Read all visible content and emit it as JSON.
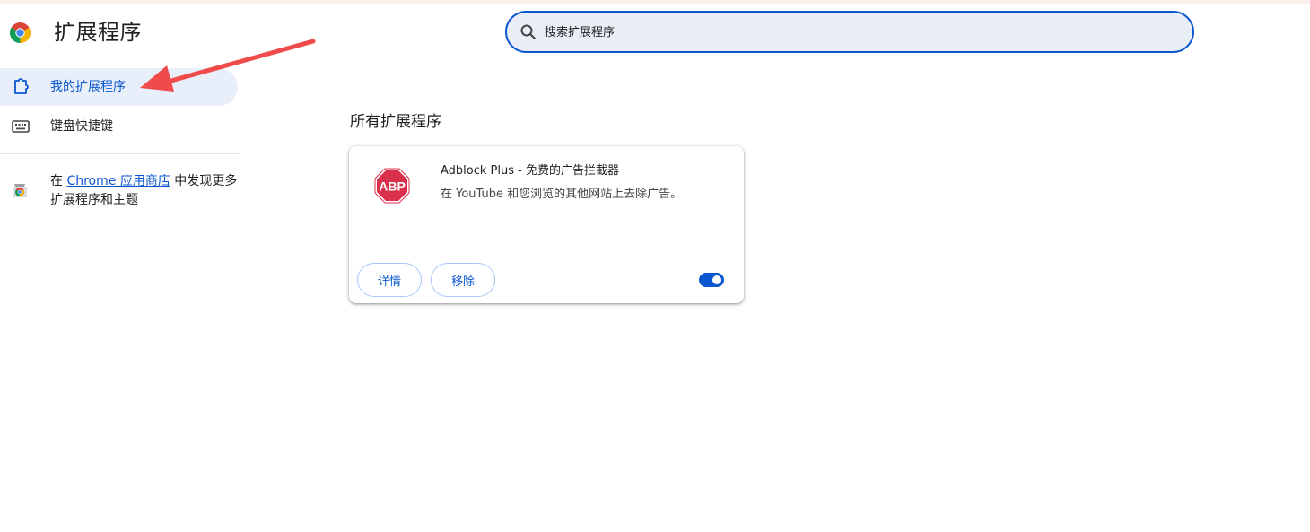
{
  "app": {
    "title": "扩展程序"
  },
  "search": {
    "placeholder": "搜索扩展程序",
    "value": ""
  },
  "sidebar": {
    "items": [
      {
        "label": "我的扩展程序",
        "icon": "puzzle-icon",
        "active": true
      },
      {
        "label": "键盘快捷键",
        "icon": "keyboard-icon",
        "active": false
      }
    ],
    "store_promo": {
      "prefix": "在 ",
      "link_text": "Chrome 应用商店",
      "suffix": " 中发现更多扩展程序和主题",
      "icon": "web-store-icon"
    }
  },
  "main": {
    "section_title": "所有扩展程序",
    "extensions": [
      {
        "name": "Adblock Plus - 免费的广告拦截器",
        "description": "在 YouTube 和您浏览的其他网站上去除广告。",
        "logo_text": "ABP",
        "details_label": "详情",
        "remove_label": "移除",
        "enabled": true
      }
    ]
  },
  "colors": {
    "accent": "#0b57d0",
    "active_nav_bg": "#e8effb",
    "search_bg": "#e9eef6",
    "abp_red": "#d9304b",
    "annotation_arrow": "#ef4b4b"
  }
}
